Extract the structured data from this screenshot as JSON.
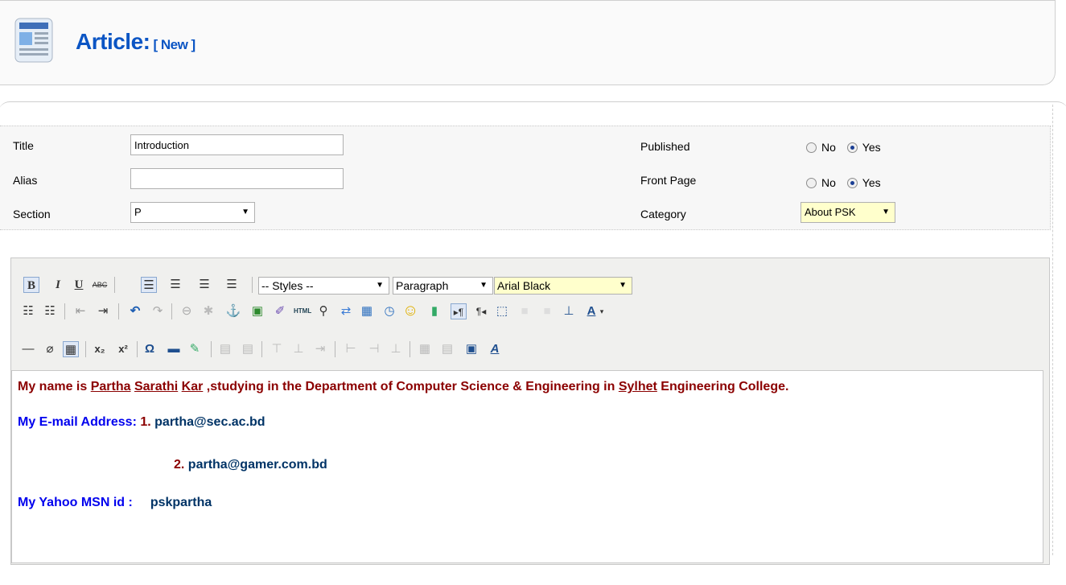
{
  "header": {
    "title": "Article:",
    "title_status": "[ New ]"
  },
  "details": {
    "title_label": "Title",
    "title_value": "Introduction",
    "alias_label": "Alias",
    "alias_value": "",
    "section_label": "Section",
    "section_value": "P",
    "published_label": "Published",
    "front_page_label": "Front Page",
    "category_label": "Category",
    "category_value": "About PSK",
    "no_label": "No",
    "yes_label": "Yes",
    "published_selected": "Yes",
    "front_page_selected": "Yes"
  },
  "toolbar": {
    "styles_value": "-- Styles --",
    "format_value": "Paragraph",
    "font_value": "Arial Black",
    "font_highlight_color": "#ffffcc",
    "icons": [
      "bold-icon",
      "italic-icon",
      "underline-icon",
      "strikethrough-icon",
      "align-left-icon",
      "align-center-icon",
      "align-right-icon",
      "align-justify-icon"
    ]
  },
  "content": {
    "line1_a": "My name is ",
    "line1_name1": "Partha",
    "line1_name2": "Sarathi",
    "line1_name3": "Kar",
    "line1_b": " ,studying in the Department of Computer Science & Engineering in ",
    "line1_place": "Sylhet",
    "line1_c": " Engineering College.",
    "email_label": "My E-mail Address:",
    "email1_num": "1.",
    "email1": "partha@sec.ac.bd",
    "email2_num": "2.",
    "email2": "partha@gamer.com.bd",
    "im_label": "My Yahoo MSN id :",
    "im_value": "pskpartha",
    "colors": {
      "dark_red": "#8b0000",
      "blue": "#0000ee",
      "navy": "#003366"
    }
  }
}
